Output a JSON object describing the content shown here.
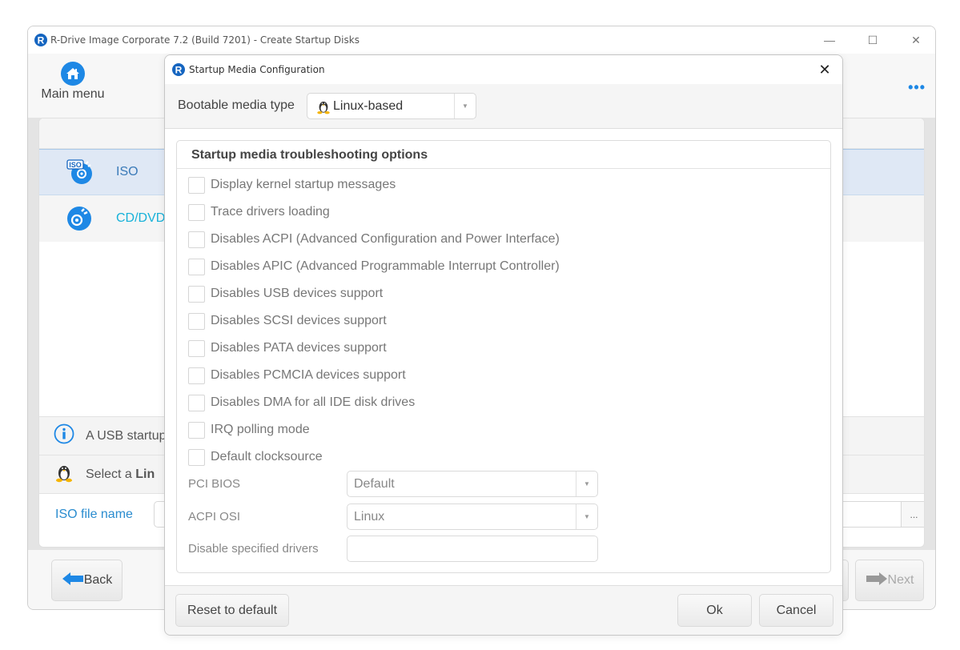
{
  "main_window": {
    "title": "R-Drive Image Corporate 7.2 (Build 7201) - Create Startup Disks",
    "controls": {
      "minimize": "—",
      "maximize": "☐",
      "close": "✕"
    },
    "toolbar": {
      "main_menu_label": "Main menu",
      "more_label": "•••"
    },
    "media_list": [
      {
        "label": "ISO",
        "icon": "iso-disc-icon",
        "selected": true
      },
      {
        "label": "CD/DVD",
        "icon": "cd-dvd-icon",
        "selected": false
      }
    ],
    "info_rows": [
      {
        "icon": "info-icon",
        "text": "A USB startup"
      },
      {
        "icon": "linux-penguin-icon",
        "text_prefix": "Select a ",
        "text_bold": "Lin"
      }
    ],
    "iso_file": {
      "label": "ISO file name",
      "value": "",
      "browse_label": "..."
    },
    "nav": {
      "back_label": "Back",
      "next_label": "Next"
    }
  },
  "dialog": {
    "title": "Startup Media Configuration",
    "close_label": "✕",
    "bootable_media_type": {
      "label": "Bootable media type",
      "value": "Linux-based"
    },
    "group_title": "Startup media troubleshooting options",
    "options": [
      {
        "label": "Display kernel startup messages",
        "checked": false
      },
      {
        "label": "Trace drivers loading",
        "checked": false
      },
      {
        "label": "Disables ACPI (Advanced Configuration and Power Interface)",
        "checked": false
      },
      {
        "label": "Disables APIC (Advanced Programmable Interrupt Controller)",
        "checked": false
      },
      {
        "label": "Disables USB devices support",
        "checked": false
      },
      {
        "label": "Disables SCSI devices support",
        "checked": false
      },
      {
        "label": "Disables PATA devices support",
        "checked": false
      },
      {
        "label": "Disables PCMCIA devices support",
        "checked": false
      },
      {
        "label": "Disables DMA for all IDE disk drives",
        "checked": false
      },
      {
        "label": "IRQ polling mode",
        "checked": false
      },
      {
        "label": "Default clocksource",
        "checked": false
      }
    ],
    "pci_bios": {
      "label": "PCI BIOS",
      "value": "Default"
    },
    "acpi_osi": {
      "label": "ACPI OSI",
      "value": "Linux"
    },
    "disable_drivers": {
      "label": "Disable specified drivers",
      "value": ""
    },
    "buttons": {
      "reset": "Reset to default",
      "ok": "Ok",
      "cancel": "Cancel"
    }
  },
  "colors": {
    "accent": "#1e88e5",
    "selection": "#dfe8f5",
    "link": "#2a8ccf"
  }
}
